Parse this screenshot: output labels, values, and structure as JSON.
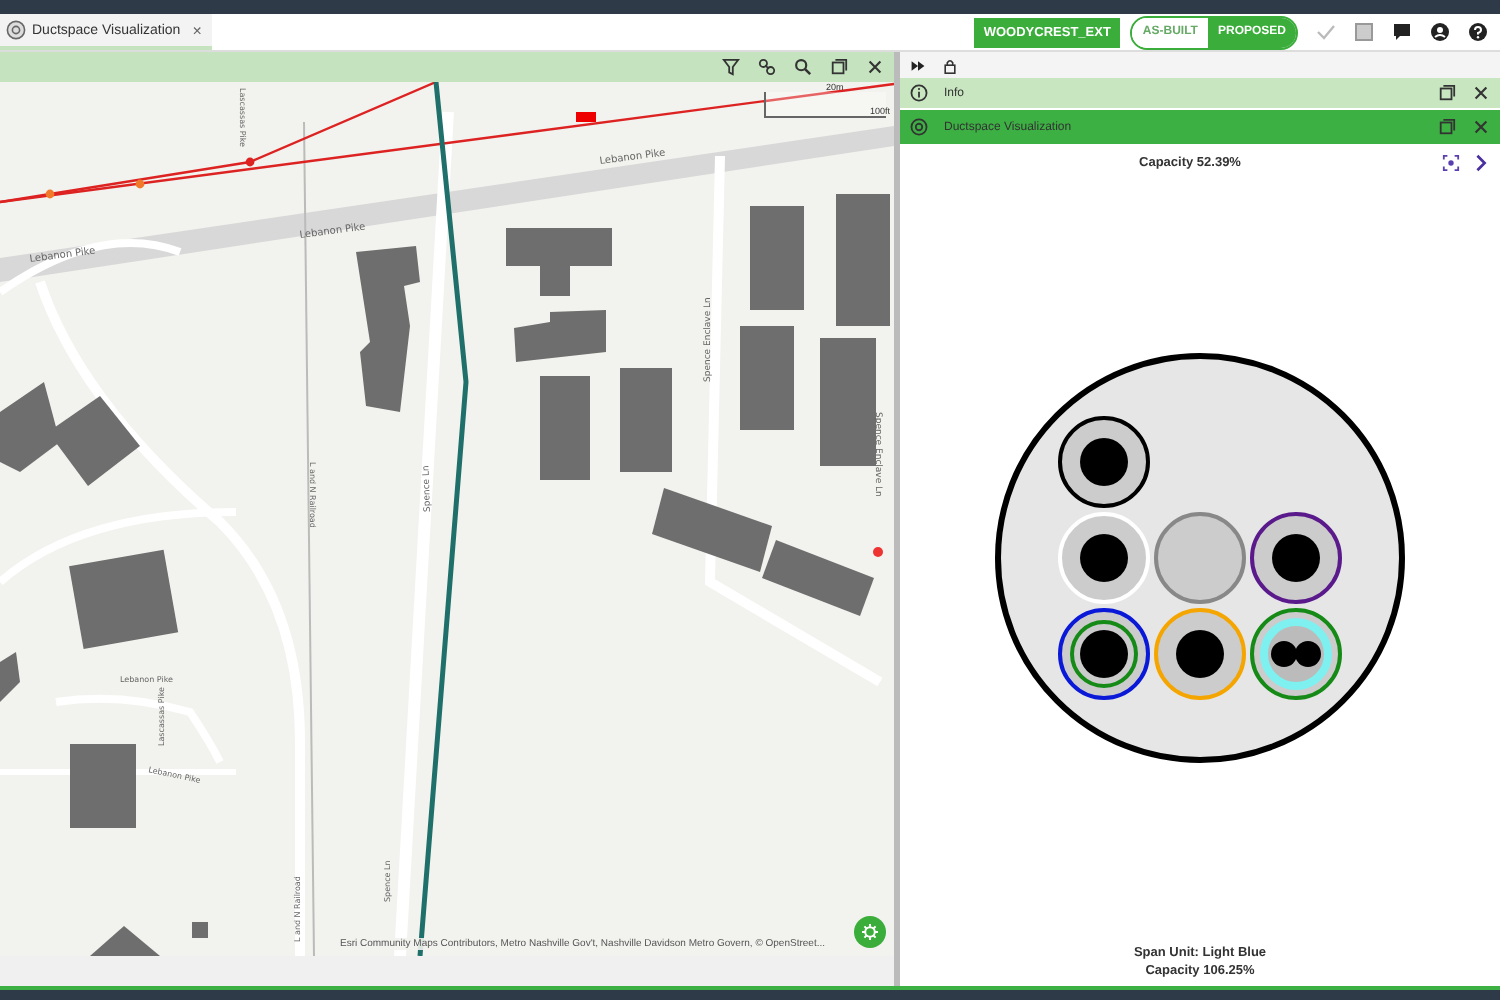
{
  "tab": {
    "label": "Ductspace Visualization",
    "close": "×"
  },
  "header": {
    "project": "WOODYCREST_EXT",
    "modes": [
      {
        "label": "AS-BUILT",
        "selected": false
      },
      {
        "label": "PROPOSED",
        "selected": true
      }
    ]
  },
  "map": {
    "scale": {
      "metric": "20m",
      "imperial": "100ft"
    },
    "labels": [
      {
        "text": "Lebanon Pike"
      },
      {
        "text": "Lebanon Pike"
      },
      {
        "text": "Lebanon Pike"
      },
      {
        "text": "Spence Ln"
      },
      {
        "text": "Spence Enclave Ln"
      },
      {
        "text": "Spence Enclave Ln"
      },
      {
        "text": "L and N Railroad"
      },
      {
        "text": "Lascassas Pike"
      },
      {
        "text": "Lebanon Pike"
      },
      {
        "text": "Lebanon Pike"
      },
      {
        "text": "Lascassas Pike"
      },
      {
        "text": "Spence Ln"
      },
      {
        "text": "L and N Railroad"
      }
    ],
    "attribution": "Esri Community Maps Contributors, Metro Nashville Gov't, Nashville Davidson Metro Govern, © OpenStreet..."
  },
  "panels": [
    {
      "title": "Info",
      "selected": false
    },
    {
      "title": "Ductspace Visualization",
      "selected": true
    }
  ],
  "viz": {
    "capacity_top": "Capacity 52.39%",
    "duct_rows": [
      [
        {
          "color": "#000000",
          "kind": "single"
        }
      ],
      [
        {
          "color": "#ffffff",
          "kind": "single"
        },
        {
          "color": "#888888",
          "kind": "empty"
        },
        {
          "color": "#5a1a8c",
          "kind": "single"
        }
      ],
      [
        {
          "color": "#0a18d8",
          "kind": "single",
          "inner_ring": {
            "color": "#168a16"
          }
        },
        {
          "color": "#f5a500",
          "kind": "single"
        },
        {
          "color": "#168a16",
          "kind": "double",
          "inner_ring": {
            "color": "#7ff0f0"
          }
        }
      ]
    ],
    "span_unit": "Span Unit: Light Blue",
    "capacity_bottom": "Capacity 106.25%"
  }
}
